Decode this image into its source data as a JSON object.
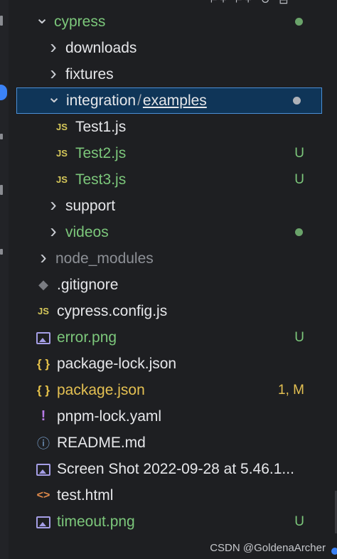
{
  "tree": {
    "cypress": {
      "label": "cypress"
    },
    "downloads": {
      "label": "downloads"
    },
    "fixtures": {
      "label": "fixtures"
    },
    "integration": {
      "label": "integration",
      "sep": "/",
      "sub": "examples"
    },
    "test1": {
      "label": "Test1.js",
      "icon": "JS"
    },
    "test2": {
      "label": "Test2.js",
      "icon": "JS",
      "status": "U"
    },
    "test3": {
      "label": "Test3.js",
      "icon": "JS",
      "status": "U"
    },
    "support": {
      "label": "support"
    },
    "videos": {
      "label": "videos"
    },
    "node_modules": {
      "label": "node_modules"
    },
    "gitignore": {
      "label": ".gitignore"
    },
    "cypress_config": {
      "label": "cypress.config.js",
      "icon": "JS"
    },
    "error_png": {
      "label": "error.png",
      "status": "U"
    },
    "package_lock": {
      "label": "package-lock.json",
      "icon": "{ }"
    },
    "package_json": {
      "label": "package.json",
      "icon": "{ }",
      "status": "1, M"
    },
    "pnpm_lock": {
      "label": "pnpm-lock.yaml",
      "icon": "!"
    },
    "readme": {
      "label": "README.md",
      "icon": "ⓘ"
    },
    "screenshot": {
      "label": "Screen Shot 2022-09-28 at 5.46.1..."
    },
    "test_html": {
      "label": "test.html",
      "icon": "<>"
    },
    "timeout_png": {
      "label": "timeout.png",
      "status": "U"
    }
  },
  "watermark": "CSDN @GoldenaArcher",
  "colors": {
    "untracked": "#7cc77b",
    "modified": "#e4c052",
    "selection": "#0f3558",
    "selection_border": "#4a8fd6"
  }
}
